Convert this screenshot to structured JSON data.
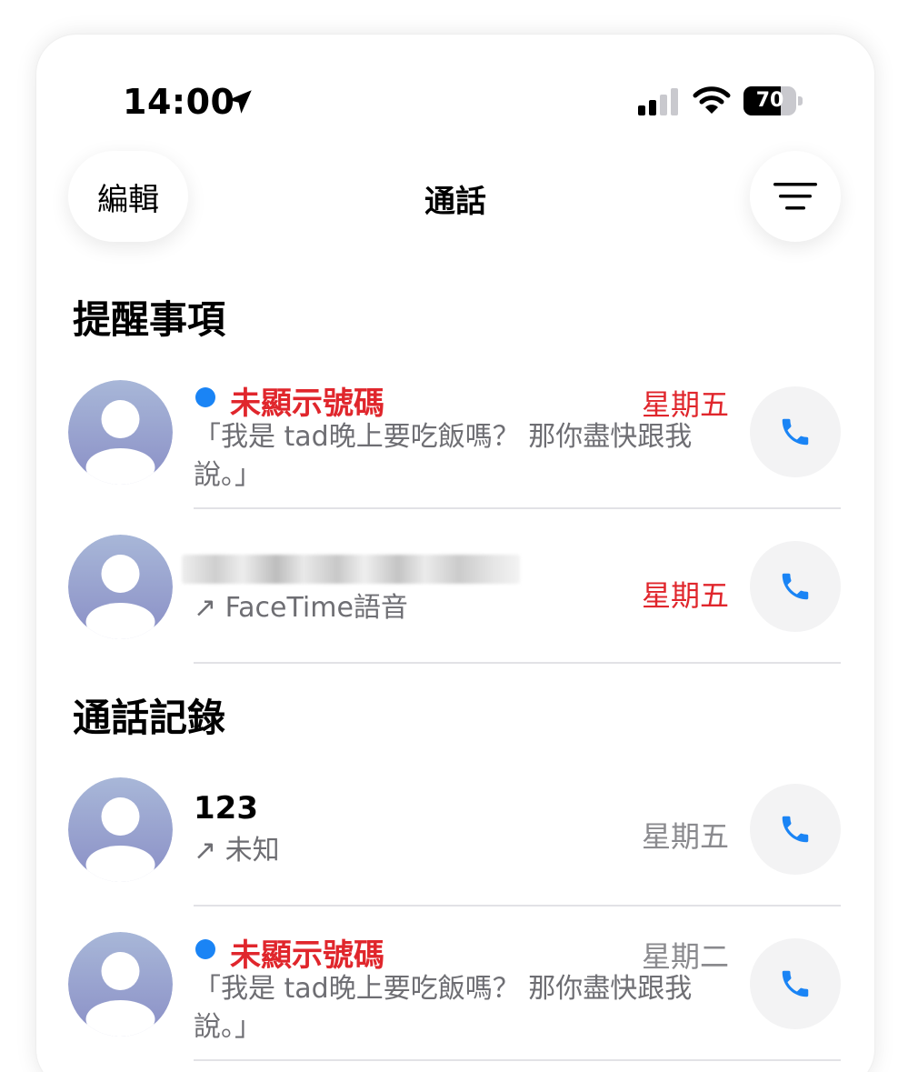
{
  "status_bar": {
    "time": "14:00",
    "battery": "70",
    "battery_level": 0.7
  },
  "nav": {
    "edit_label": "編輯",
    "title": "通話"
  },
  "sections": {
    "reminders_title": "提醒事項",
    "recents_title": "通話記錄"
  },
  "reminders": [
    {
      "name": "未顯示號碼",
      "preview": "「我是 tad晚上要吃飯嗎？ 那你盡快跟我說。」",
      "date": "星期五"
    },
    {
      "name": "",
      "subtitle": "↗ FaceTime語音",
      "date": "星期五"
    }
  ],
  "recents": [
    {
      "name": "123",
      "subtitle": "↗ 未知",
      "date": "星期五"
    },
    {
      "name": "未顯示號碼",
      "preview": "「我是 tad晚上要吃飯嗎？ 那你盡快跟我說。」",
      "date": "星期二"
    }
  ],
  "colors": {
    "accent": "#1a84f5",
    "missed": "#e0262c",
    "secondary_text": "#8a8a8e"
  },
  "icons": {
    "location": "location-arrow-icon",
    "signal": "cellular-signal-icon",
    "wifi": "wifi-icon",
    "filter": "filter-lines-icon",
    "call": "phone-icon",
    "avatar": "person-silhouette-icon"
  }
}
